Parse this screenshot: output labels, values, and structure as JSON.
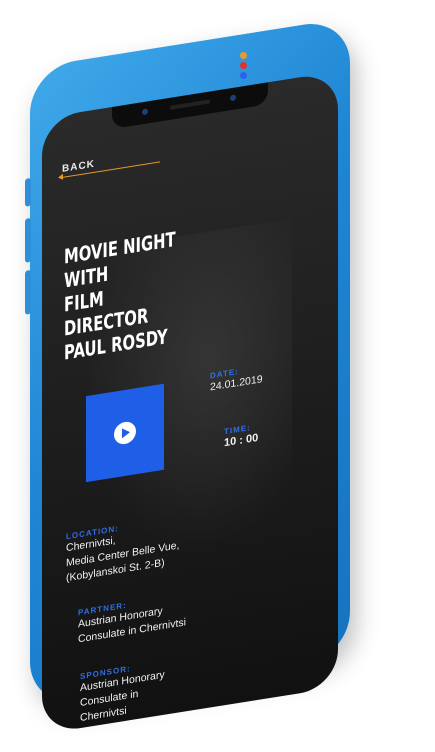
{
  "nav": {
    "back_label": "BACK"
  },
  "indicator_colors": [
    "#e59a2b",
    "#e0312b",
    "#2466e8"
  ],
  "event": {
    "title_line1": "MOVIE NIGHT WITH",
    "title_line2": "FILM DIRECTOR",
    "title_line3": "PAUL ROSDY"
  },
  "details": {
    "date_label": "DATE:",
    "date_value": "24.01.2019",
    "time_label": "TIME:",
    "time_value": "10 : 00",
    "location_label": "LOCATION:",
    "location_line1": "Chernivtsi,",
    "location_line2": "Media Center Belle Vue,",
    "location_line3": "(Kobylanskoi St. 2-B)",
    "partner_label": "PARTNER:",
    "partner_line1": "Austrian Honorary",
    "partner_line2": "Consulate in Chernivtsi",
    "sponsor_label": "SPONSOR:",
    "sponsor_line1": "Austrian Honorary",
    "sponsor_line2": "Consulate in",
    "sponsor_line3": "Chernivtsi"
  },
  "colors": {
    "device_blue": "#2b8fe0",
    "accent_blue": "#1f5fe8",
    "accent_orange": "#e59a2b",
    "screen_bg": "#1f1f1f"
  },
  "icons": {
    "play": "play-icon",
    "back": "arrow-left-icon"
  }
}
